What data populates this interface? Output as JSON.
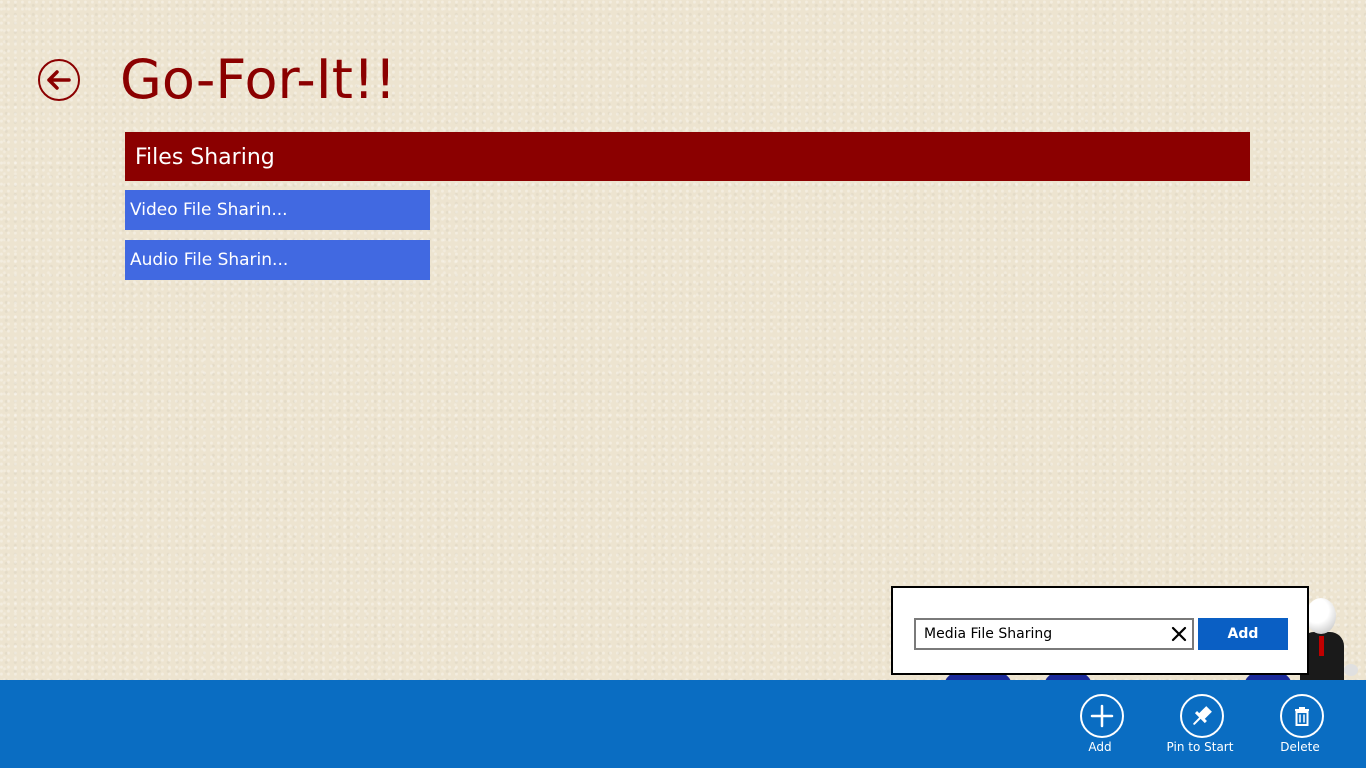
{
  "app": {
    "title": "Go-For-It!!"
  },
  "group": {
    "header": "Files Sharing",
    "items": [
      {
        "label": "Video File Sharin..."
      },
      {
        "label": "Audio File Sharin..."
      }
    ]
  },
  "flyout": {
    "input_value": "Media File Sharing",
    "add_label": "Add"
  },
  "app_bar": {
    "buttons": [
      {
        "label": "Add",
        "icon": "plus-icon"
      },
      {
        "label": "Pin to Start",
        "icon": "pin-icon"
      },
      {
        "label": "Delete",
        "icon": "trash-icon"
      }
    ]
  },
  "colors": {
    "title": "#8b0000",
    "group_header_bg": "#8b0000",
    "item_tile_bg": "#4169e1",
    "app_bar_bg": "#0a6dc2",
    "flyout_button_bg": "#0a5fc4"
  }
}
